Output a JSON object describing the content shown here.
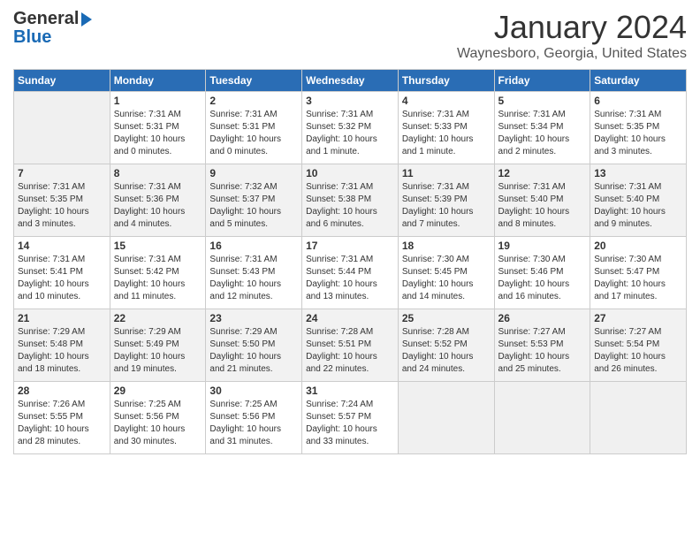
{
  "header": {
    "logo_line1": "General",
    "logo_line2": "Blue",
    "month_year": "January 2024",
    "location": "Waynesboro, Georgia, United States"
  },
  "days_of_week": [
    "Sunday",
    "Monday",
    "Tuesday",
    "Wednesday",
    "Thursday",
    "Friday",
    "Saturday"
  ],
  "weeks": [
    [
      {
        "day": "",
        "sunrise": "",
        "sunset": "",
        "daylight": ""
      },
      {
        "day": "1",
        "sunrise": "Sunrise: 7:31 AM",
        "sunset": "Sunset: 5:31 PM",
        "daylight": "Daylight: 10 hours and 0 minutes."
      },
      {
        "day": "2",
        "sunrise": "Sunrise: 7:31 AM",
        "sunset": "Sunset: 5:31 PM",
        "daylight": "Daylight: 10 hours and 0 minutes."
      },
      {
        "day": "3",
        "sunrise": "Sunrise: 7:31 AM",
        "sunset": "Sunset: 5:32 PM",
        "daylight": "Daylight: 10 hours and 1 minute."
      },
      {
        "day": "4",
        "sunrise": "Sunrise: 7:31 AM",
        "sunset": "Sunset: 5:33 PM",
        "daylight": "Daylight: 10 hours and 1 minute."
      },
      {
        "day": "5",
        "sunrise": "Sunrise: 7:31 AM",
        "sunset": "Sunset: 5:34 PM",
        "daylight": "Daylight: 10 hours and 2 minutes."
      },
      {
        "day": "6",
        "sunrise": "Sunrise: 7:31 AM",
        "sunset": "Sunset: 5:35 PM",
        "daylight": "Daylight: 10 hours and 3 minutes."
      }
    ],
    [
      {
        "day": "7",
        "sunrise": "Sunrise: 7:31 AM",
        "sunset": "Sunset: 5:35 PM",
        "daylight": "Daylight: 10 hours and 3 minutes."
      },
      {
        "day": "8",
        "sunrise": "Sunrise: 7:31 AM",
        "sunset": "Sunset: 5:36 PM",
        "daylight": "Daylight: 10 hours and 4 minutes."
      },
      {
        "day": "9",
        "sunrise": "Sunrise: 7:32 AM",
        "sunset": "Sunset: 5:37 PM",
        "daylight": "Daylight: 10 hours and 5 minutes."
      },
      {
        "day": "10",
        "sunrise": "Sunrise: 7:31 AM",
        "sunset": "Sunset: 5:38 PM",
        "daylight": "Daylight: 10 hours and 6 minutes."
      },
      {
        "day": "11",
        "sunrise": "Sunrise: 7:31 AM",
        "sunset": "Sunset: 5:39 PM",
        "daylight": "Daylight: 10 hours and 7 minutes."
      },
      {
        "day": "12",
        "sunrise": "Sunrise: 7:31 AM",
        "sunset": "Sunset: 5:40 PM",
        "daylight": "Daylight: 10 hours and 8 minutes."
      },
      {
        "day": "13",
        "sunrise": "Sunrise: 7:31 AM",
        "sunset": "Sunset: 5:40 PM",
        "daylight": "Daylight: 10 hours and 9 minutes."
      }
    ],
    [
      {
        "day": "14",
        "sunrise": "Sunrise: 7:31 AM",
        "sunset": "Sunset: 5:41 PM",
        "daylight": "Daylight: 10 hours and 10 minutes."
      },
      {
        "day": "15",
        "sunrise": "Sunrise: 7:31 AM",
        "sunset": "Sunset: 5:42 PM",
        "daylight": "Daylight: 10 hours and 11 minutes."
      },
      {
        "day": "16",
        "sunrise": "Sunrise: 7:31 AM",
        "sunset": "Sunset: 5:43 PM",
        "daylight": "Daylight: 10 hours and 12 minutes."
      },
      {
        "day": "17",
        "sunrise": "Sunrise: 7:31 AM",
        "sunset": "Sunset: 5:44 PM",
        "daylight": "Daylight: 10 hours and 13 minutes."
      },
      {
        "day": "18",
        "sunrise": "Sunrise: 7:30 AM",
        "sunset": "Sunset: 5:45 PM",
        "daylight": "Daylight: 10 hours and 14 minutes."
      },
      {
        "day": "19",
        "sunrise": "Sunrise: 7:30 AM",
        "sunset": "Sunset: 5:46 PM",
        "daylight": "Daylight: 10 hours and 16 minutes."
      },
      {
        "day": "20",
        "sunrise": "Sunrise: 7:30 AM",
        "sunset": "Sunset: 5:47 PM",
        "daylight": "Daylight: 10 hours and 17 minutes."
      }
    ],
    [
      {
        "day": "21",
        "sunrise": "Sunrise: 7:29 AM",
        "sunset": "Sunset: 5:48 PM",
        "daylight": "Daylight: 10 hours and 18 minutes."
      },
      {
        "day": "22",
        "sunrise": "Sunrise: 7:29 AM",
        "sunset": "Sunset: 5:49 PM",
        "daylight": "Daylight: 10 hours and 19 minutes."
      },
      {
        "day": "23",
        "sunrise": "Sunrise: 7:29 AM",
        "sunset": "Sunset: 5:50 PM",
        "daylight": "Daylight: 10 hours and 21 minutes."
      },
      {
        "day": "24",
        "sunrise": "Sunrise: 7:28 AM",
        "sunset": "Sunset: 5:51 PM",
        "daylight": "Daylight: 10 hours and 22 minutes."
      },
      {
        "day": "25",
        "sunrise": "Sunrise: 7:28 AM",
        "sunset": "Sunset: 5:52 PM",
        "daylight": "Daylight: 10 hours and 24 minutes."
      },
      {
        "day": "26",
        "sunrise": "Sunrise: 7:27 AM",
        "sunset": "Sunset: 5:53 PM",
        "daylight": "Daylight: 10 hours and 25 minutes."
      },
      {
        "day": "27",
        "sunrise": "Sunrise: 7:27 AM",
        "sunset": "Sunset: 5:54 PM",
        "daylight": "Daylight: 10 hours and 26 minutes."
      }
    ],
    [
      {
        "day": "28",
        "sunrise": "Sunrise: 7:26 AM",
        "sunset": "Sunset: 5:55 PM",
        "daylight": "Daylight: 10 hours and 28 minutes."
      },
      {
        "day": "29",
        "sunrise": "Sunrise: 7:25 AM",
        "sunset": "Sunset: 5:56 PM",
        "daylight": "Daylight: 10 hours and 30 minutes."
      },
      {
        "day": "30",
        "sunrise": "Sunrise: 7:25 AM",
        "sunset": "Sunset: 5:56 PM",
        "daylight": "Daylight: 10 hours and 31 minutes."
      },
      {
        "day": "31",
        "sunrise": "Sunrise: 7:24 AM",
        "sunset": "Sunset: 5:57 PM",
        "daylight": "Daylight: 10 hours and 33 minutes."
      },
      {
        "day": "",
        "sunrise": "",
        "sunset": "",
        "daylight": ""
      },
      {
        "day": "",
        "sunrise": "",
        "sunset": "",
        "daylight": ""
      },
      {
        "day": "",
        "sunrise": "",
        "sunset": "",
        "daylight": ""
      }
    ]
  ]
}
